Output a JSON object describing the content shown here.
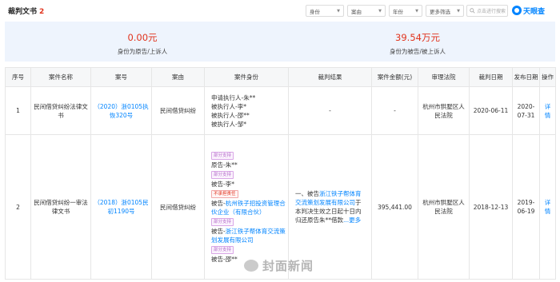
{
  "header": {
    "title": "裁判文书",
    "count": "2",
    "filters": [
      "身份",
      "案由",
      "年份",
      "更多筛选"
    ],
    "search_placeholder": "点击进行搜索",
    "brand": "天眼查"
  },
  "summary": [
    {
      "value": "0.00元",
      "label": "身份为原告/上诉人"
    },
    {
      "value": "39.54万元",
      "label": "身份为被告/被上诉人"
    }
  ],
  "columns": [
    "序号",
    "案件名称",
    "案号",
    "案由",
    "案件身份",
    "裁判结果",
    "案件金额(元)",
    "审理法院",
    "裁判日期",
    "发布日期",
    "操作"
  ],
  "rows": [
    {
      "index": "1",
      "name": "民间借贷纠纷法律文书",
      "case_no": "（2020）浙0105执恢320号",
      "cause": "民间借贷纠纷",
      "roles": [
        "申请执行人-朱**",
        "被执行人-李*",
        "被执行人-邵**",
        "被执行人-邹*"
      ],
      "result": "-",
      "amount": "-",
      "court": "杭州市拱墅区人民法院",
      "judge_date": "2020-06-11",
      "publish_date": "2020-07-31",
      "action": "详情"
    },
    {
      "index": "2",
      "name": "民间借贷纠纷一审法律文书",
      "case_no": "（2018）浙0105民初1190号",
      "cause": "民间借贷纠纷",
      "role_items": [
        {
          "tag": "部分支持",
          "tag_style": "purple",
          "text": "原告-朱**"
        },
        {
          "tag": "部分支持",
          "tag_style": "purple",
          "text": "被告-李*"
        },
        {
          "tag": "不承担责任",
          "tag_style": "red",
          "text": "被告-杭州铁子招投资管理合伙企业（有限合伙）"
        },
        {
          "tag": "部分支持",
          "tag_style": "purple",
          "text": "被告-浙江铁子帮体育交流策划发展有限公司"
        },
        {
          "tag": "部分支持",
          "tag_style": "purple",
          "text": "被告-邵**"
        }
      ],
      "result_prefix": "一、被告",
      "result_company": "浙江铁子帮体育交流策划发展有限公司",
      "result_suffix": "于本判决生效之日起十日内归还原告朱**借款",
      "result_more": "...更多",
      "amount": "395,441.00",
      "court": "杭州市拱墅区人民法院",
      "judge_date": "2018-12-13",
      "publish_date": "2019-06-19",
      "action": "详情"
    }
  ],
  "watermark": "封面新闻",
  "colors": {
    "accent": "#0084ff",
    "red": "#e1331d",
    "summary_bg": "#eef4fd",
    "tag_purple": "#b46bc9"
  }
}
